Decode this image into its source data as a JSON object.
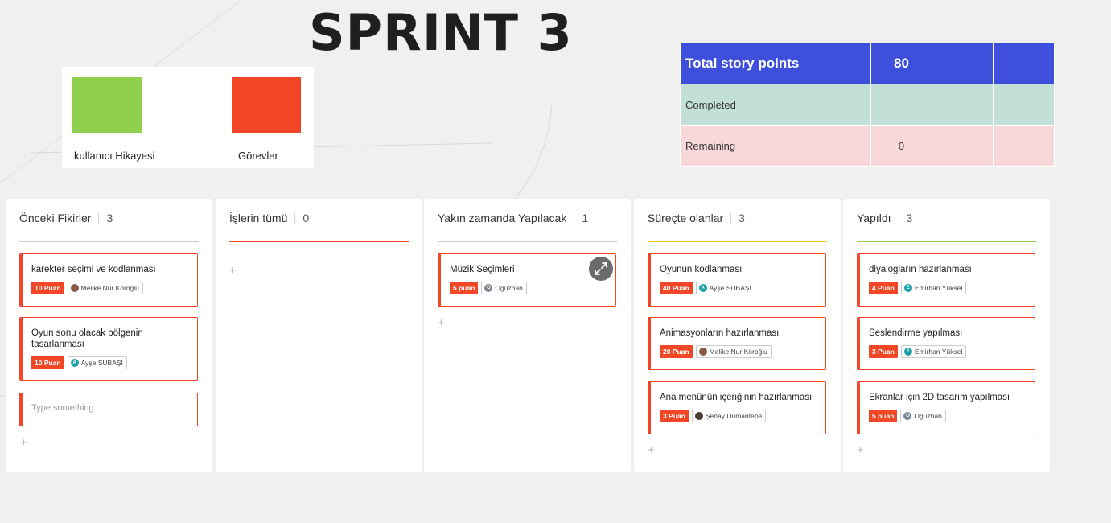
{
  "board": {
    "title": "SPRINT 3"
  },
  "legend": {
    "items": [
      {
        "label": "kullanıcı Hikayesi",
        "color": "#8fd14f"
      },
      {
        "label": "Görevler",
        "color": "#f24726"
      }
    ]
  },
  "story_table": {
    "rows": [
      {
        "label": "Total story points",
        "value": "80",
        "color": "#3d4fdb"
      },
      {
        "label": "Completed",
        "value": "",
        "color": "#c3e0d8"
      },
      {
        "label": "Remaining",
        "value": "0",
        "color": "#f8d8d9"
      }
    ]
  },
  "columns": [
    {
      "name": "Önceki Fikirler",
      "count": "3",
      "accent": "#cccccc",
      "cards": [
        {
          "title": "karekter seçimi ve kodlanması",
          "points": "10 Puan",
          "user": "Melike Nur Köroğlu",
          "avatar": "photo"
        },
        {
          "title": "Oyun sonu olacak bölgenin tasarlanması",
          "points": "10 Puan",
          "user": "Ayşe SUBAŞI",
          "avatar": "A"
        }
      ],
      "input_placeholder": "Type something",
      "add": "+"
    },
    {
      "name": "İşlerin tümü",
      "count": "0",
      "accent": "#f24726",
      "cards": [],
      "add": "+"
    },
    {
      "name": "Yakın zamanda Yapılacak",
      "count": "1",
      "accent": "#cccccc",
      "cards": [
        {
          "title": "Müzik Seçimleri",
          "points": "5 puan",
          "user": "Oğuzhan",
          "avatar": "O"
        }
      ],
      "add": "+"
    },
    {
      "name": "Süreçte olanlar",
      "count": "3",
      "accent": "#fac710",
      "cards": [
        {
          "title": "Oyunun kodlanması",
          "points": "40 Puan",
          "user": "Ayşe SUBAŞI",
          "avatar": "A"
        },
        {
          "title": "Animasyonların hazırlanması",
          "points": "20 Puan",
          "user": "Melike Nur Köroğlu",
          "avatar": "photo"
        },
        {
          "title": "Ana menünün içeriğinin hazırlanması",
          "points": "3 Puan",
          "user": "Şenay Dumantepe",
          "avatar": "photo"
        }
      ],
      "add": "+"
    },
    {
      "name": "Yapıldı",
      "count": "3",
      "accent": "#8fd14f",
      "cards": [
        {
          "title": "diyalogların hazırlanması",
          "points": "4 Puan",
          "user": "Emirhan Yüksel",
          "avatar": "E"
        },
        {
          "title": "Seslendirme yapılması",
          "points": "3 Puan",
          "user": "Emirhan Yüksel",
          "avatar": "E"
        },
        {
          "title": "Ekranlar için 2D tasarım yapılması",
          "points": "5 puan",
          "user": "Oğuzhan",
          "avatar": "O"
        }
      ],
      "add": "+"
    }
  ],
  "icons": {
    "expand": "expand-icon"
  }
}
